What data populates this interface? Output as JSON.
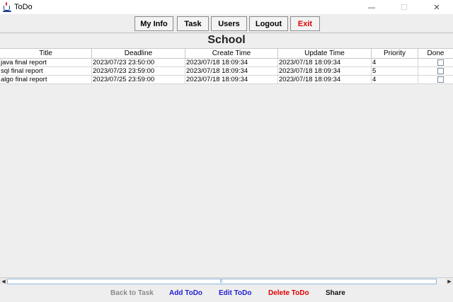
{
  "window": {
    "title": "ToDo",
    "minimize_glyph": "—",
    "maximize_glyph": "☐",
    "close_glyph": "✕"
  },
  "nav": {
    "my_info": "My Info",
    "task": "Task",
    "users": "Users",
    "logout": "Logout",
    "exit": "Exit"
  },
  "page": {
    "title": "School"
  },
  "table": {
    "headers": [
      "Title",
      "Deadline",
      "Create Time",
      "Update Time",
      "Priority",
      "Done"
    ],
    "rows": [
      {
        "title": "java final report",
        "deadline": "2023/07/23 23:50:00",
        "create": "2023/07/18 18:09:34",
        "update": "2023/07/18 18:09:34",
        "priority": "4",
        "done": false
      },
      {
        "title": "sql final report",
        "deadline": "2023/07/23 23:59:00",
        "create": "2023/07/18 18:09:34",
        "update": "2023/07/18 18:09:34",
        "priority": "5",
        "done": false
      },
      {
        "title": "algo final report",
        "deadline": "2023/07/25 23:59:00",
        "create": "2023/07/18 18:09:34",
        "update": "2023/07/18 18:09:34",
        "priority": "4",
        "done": false
      }
    ]
  },
  "scrollbar": {
    "left_arrow": "◀",
    "right_arrow": "▶"
  },
  "actions": {
    "back_to_task": "Back to Task",
    "add_todo": "Add ToDo",
    "edit_todo": "Edit ToDo",
    "delete_todo": "Delete ToDo",
    "share": "Share"
  },
  "colors": {
    "exit": "#e00000",
    "add_edit": "#1f1fd4",
    "delete": "#e00000",
    "disabled": "#8a8a8a"
  }
}
